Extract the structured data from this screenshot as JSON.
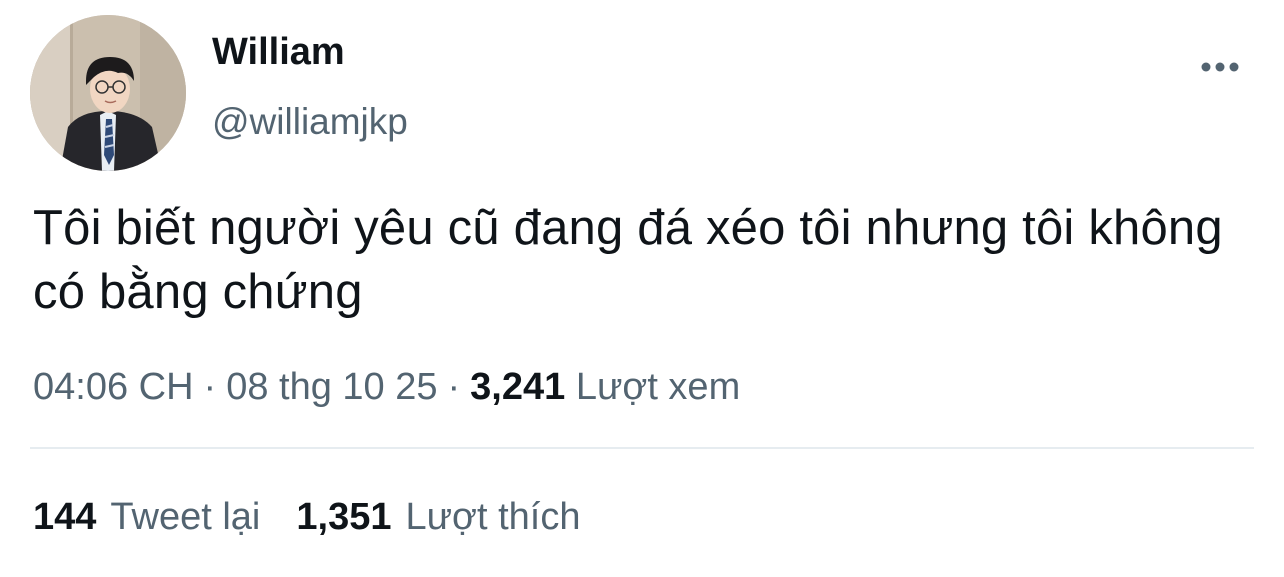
{
  "tweet": {
    "author": {
      "display_name": "William",
      "handle": "@williamjkp"
    },
    "text": "Tôi biết người yêu cũ đang đá xéo tôi nhưng tôi không có bằng chứng",
    "time": "04:06 CH",
    "separator": "·",
    "date": "08 thg 10 25",
    "views_count": "3,241",
    "views_label": "Lượt xem",
    "retweets_count": "144",
    "retweets_label": "Tweet lại",
    "likes_count": "1,351",
    "likes_label": "Lượt thích"
  },
  "icons": {
    "more": "more-horizontal-icon"
  },
  "colors": {
    "primary_text": "#0f1419",
    "secondary_text": "#536471",
    "divider": "#e6ecf0"
  }
}
